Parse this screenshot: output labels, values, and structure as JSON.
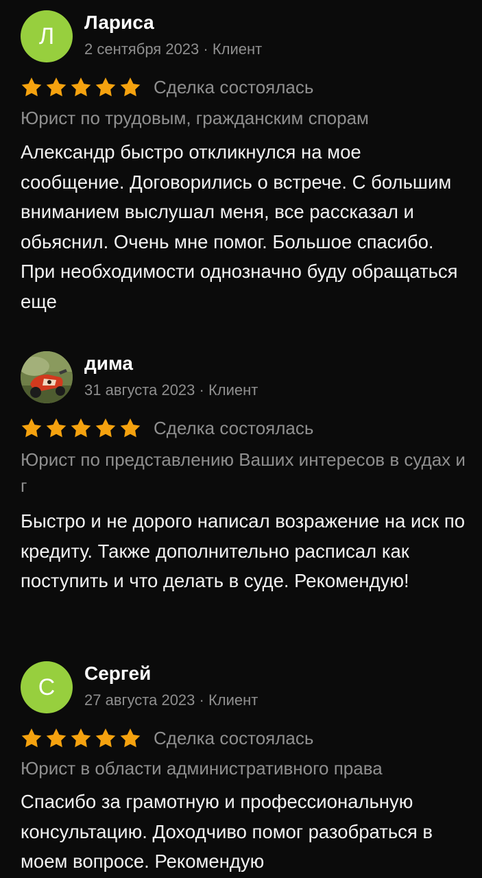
{
  "colors": {
    "background": "#0b0b0b",
    "avatar_green": "#97cf3e",
    "star_orange": "#f5a20f",
    "muted_text": "#8f8f8f"
  },
  "reviews": [
    {
      "avatar_letter": "Л",
      "avatar_type": "letter",
      "name": "Лариса",
      "meta": "2 сентября 2023 · Клиент",
      "rating": 5,
      "deal_status": "Сделка состоялась",
      "service": "Юрист по трудовым, гражданским спорам",
      "text": "Александр быстро откликнулся на мое сообщение. Договорились о встрече. С большим вниманием выслушал меня, все рассказал и обьяснил. Очень мне помог. Большое спасибо. При необходимости однозначно буду обращаться еще"
    },
    {
      "avatar_type": "photo",
      "avatar_icon": "motorcycle-photo-avatar",
      "name": "дима",
      "meta": "31 августа 2023 · Клиент",
      "rating": 5,
      "deal_status": "Сделка состоялась",
      "service": "Юрист по представлению Ваших интересов в судах и г",
      "text": "Быстро и не дорого написал возражение на иск по кредиту. Также дополнительно расписал как поступить и что делать в суде. Рекомендую!"
    },
    {
      "avatar_letter": "С",
      "avatar_type": "letter",
      "name": "Сергей",
      "meta": "27 августа 2023 · Клиент",
      "rating": 5,
      "deal_status": "Сделка состоялась",
      "service": "Юрист в области административного права",
      "text": "Спасибо за грамотную и профессиональную консультацию. Доходчиво помог разобраться в моем вопросе. Рекомендую"
    }
  ]
}
